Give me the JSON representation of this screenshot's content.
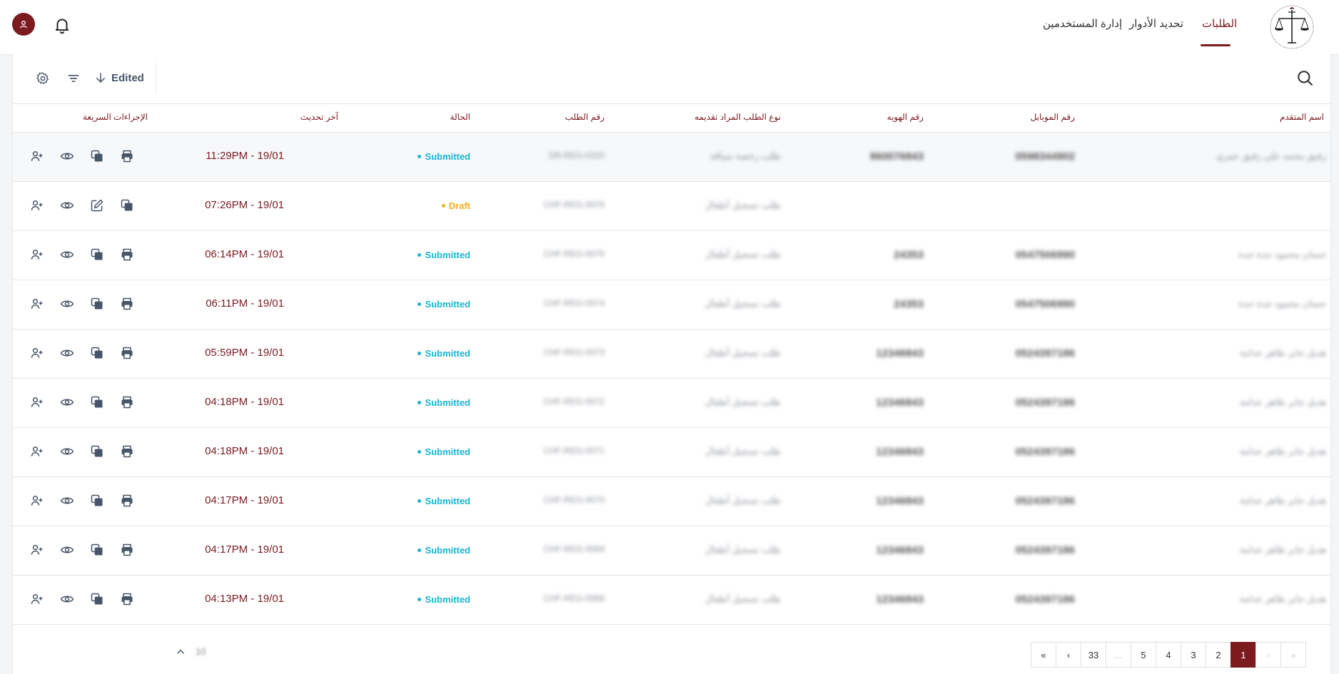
{
  "nav": {
    "items": [
      "الطلبات",
      "تحديد الأدوار",
      "إدارة المستخدمين"
    ],
    "active_index": 0
  },
  "logo": {
    "caption": "Society of St. Yves"
  },
  "toolbar": {
    "sort_label": "Edited"
  },
  "table": {
    "headers": [
      "اسم المتقدم",
      "رقم الموبايل",
      "رقم الهويه",
      "نوع الطلب المراد تقديمه",
      "رقم الطلب",
      "الحالة",
      "آخر تحديث",
      "الإجراءات السريعة"
    ],
    "rows": [
      {
        "name": "رفيق محمد علي رفيق عمري",
        "mobile": "0598344902",
        "id": "860076843",
        "type": "طلب رخصة سياقة",
        "request": "DR-REG-0220",
        "status": "Submitted",
        "updated": "11:29PM - 19/01"
      },
      {
        "name": "",
        "mobile": "",
        "id": "",
        "type": "طلب تسجيل أطفال",
        "request": "CHF-REG-0076",
        "status": "Draft",
        "updated": "07:26PM - 19/01"
      },
      {
        "name": "حسان محمود جدة جدة",
        "mobile": "0547506990",
        "id": "24353",
        "type": "طلب تسجيل أطفال",
        "request": "CHF-REG-0075",
        "status": "Submitted",
        "updated": "06:14PM - 19/01"
      },
      {
        "name": "حسان محمود جدة جدة",
        "mobile": "0547506990",
        "id": "24353",
        "type": "طلب تسجيل أطفال",
        "request": "CHF-REG-0074",
        "status": "Submitted",
        "updated": "06:11PM - 19/01"
      },
      {
        "name": "هديل جابر طاهر عدامة",
        "mobile": "0524397186",
        "id": "12346843",
        "type": "طلب تسجيل أطفال",
        "request": "CHF-REG-0073",
        "status": "Submitted",
        "updated": "05:59PM - 19/01"
      },
      {
        "name": "هديل جابر طاهر عدامة",
        "mobile": "0524397186",
        "id": "12346843",
        "type": "طلب تسجيل أطفال",
        "request": "CHF-REG-0072",
        "status": "Submitted",
        "updated": "04:18PM - 19/01"
      },
      {
        "name": "هديل جابر طاهر عدامة",
        "mobile": "0524397186",
        "id": "12346843",
        "type": "طلب تسجيل أطفال",
        "request": "CHF-REG-0071",
        "status": "Submitted",
        "updated": "04:18PM - 19/01"
      },
      {
        "name": "هديل جابر طاهر عدامة",
        "mobile": "0524397186",
        "id": "12346843",
        "type": "طلب تسجيل أطفال",
        "request": "CHF-REG-0070",
        "status": "Submitted",
        "updated": "04:17PM - 19/01"
      },
      {
        "name": "هديل جابر طاهر عدامة",
        "mobile": "0524397186",
        "id": "12346843",
        "type": "طلب تسجيل أطفال",
        "request": "CHF-REG-0069",
        "status": "Submitted",
        "updated": "04:17PM - 19/01"
      },
      {
        "name": "هديل جابر طاهر عدامة",
        "mobile": "0524397186",
        "id": "12346843",
        "type": "طلب تسجيل أطفال",
        "request": "CHF-REG-0068",
        "status": "Submitted",
        "updated": "04:13PM - 19/01"
      }
    ]
  },
  "status_colors": {
    "Submitted": "#17b6d1",
    "Draft": "#f2b01e"
  },
  "pagination": {
    "pages": [
      "«",
      "‹",
      "33",
      "...",
      "5",
      "4",
      "3",
      "2",
      "1",
      "›",
      "»"
    ],
    "active_page": "1",
    "page_size": "10"
  },
  "colors": {
    "brand": "#7b1b20",
    "icon": "#475569"
  }
}
